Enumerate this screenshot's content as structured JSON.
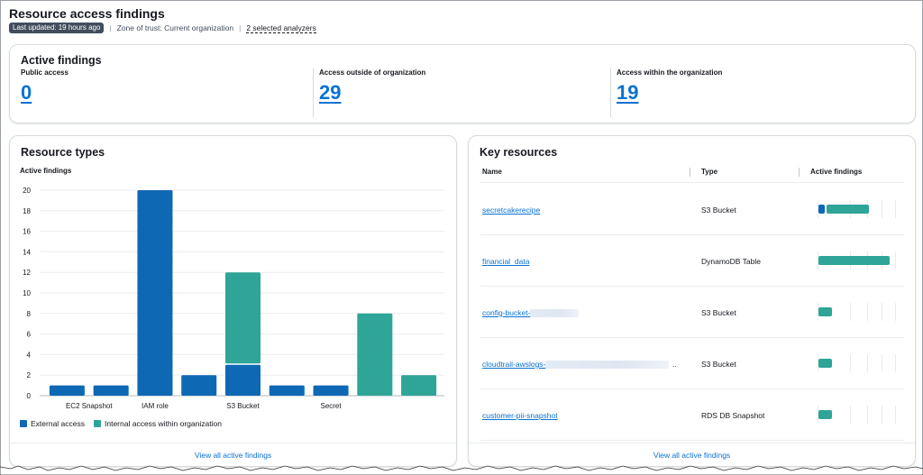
{
  "header": {
    "title": "Resource access findings",
    "last_updated": "Last updated: 19 hours ago",
    "zone_of_trust": "Zone of trust: Current organization",
    "analyzers_link": "2 selected analyzers"
  },
  "active_findings": {
    "title": "Active findings",
    "public_access": {
      "label": "Public access",
      "value": "0"
    },
    "outside_org": {
      "label": "Access outside of organization",
      "value": "29"
    },
    "within_org": {
      "label": "Access within the organization",
      "value": "19"
    }
  },
  "resource_types": {
    "title": "Resource types",
    "subtitle": "Active findings",
    "footer_link": "View all active findings",
    "legend": {
      "external": "External access",
      "internal": "Internal access within organization"
    }
  },
  "chart_data": {
    "type": "bar",
    "stacked": true,
    "ylabel": "Active findings",
    "ylim": [
      0,
      20
    ],
    "yticks": [
      0,
      2,
      4,
      6,
      8,
      10,
      12,
      14,
      16,
      18,
      20
    ],
    "grid": true,
    "legend_position": "bottom-left",
    "x_tick_labels": [
      "EC2 Snapshot",
      "IAM role",
      "S3 Bucket",
      "Secret"
    ],
    "x_tick_positions": [
      0.5,
      2,
      4,
      6
    ],
    "bars": [
      {
        "external": 1,
        "internal": 0
      },
      {
        "external": 1,
        "internal": 0
      },
      {
        "external": 20,
        "internal": 0
      },
      {
        "external": 2,
        "internal": 0
      },
      {
        "external": 3,
        "internal": 9
      },
      {
        "external": 1,
        "internal": 0
      },
      {
        "external": 1,
        "internal": 0
      },
      {
        "external": 0,
        "internal": 8
      },
      {
        "external": 0,
        "internal": 2
      }
    ],
    "series": [
      {
        "name": "External access",
        "color": "#0f68b4"
      },
      {
        "name": "Internal access within organization",
        "color": "#2ea597"
      }
    ]
  },
  "key_resources": {
    "title": "Key resources",
    "columns": {
      "name": "Name",
      "type": "Type",
      "findings": "Active findings"
    },
    "rows": [
      {
        "name": "secretcakerecipe",
        "type": "S3 Bucket",
        "external": 1,
        "internal": 6,
        "redacted": false
      },
      {
        "name": "financial_data",
        "type": "DynamoDB Table",
        "external": 0,
        "internal": 10,
        "redacted": false
      },
      {
        "name": "config-bucket-",
        "type": "S3 Bucket",
        "external": 0,
        "internal": 2,
        "redacted": true
      },
      {
        "name": "cloudtrail-awslogs-",
        "type": "S3 Bucket",
        "external": 0,
        "internal": 2,
        "redacted": true,
        "ellipsis": ".."
      },
      {
        "name": "customer-pii-snapshot",
        "type": "RDS DB Snapshot",
        "external": 0,
        "internal": 2,
        "redacted": false
      }
    ],
    "scale_max": 10,
    "footer_link": "View all active findings"
  },
  "colors": {
    "external": "#0f68b4",
    "internal": "#2ea597",
    "link": "#0972d3"
  }
}
